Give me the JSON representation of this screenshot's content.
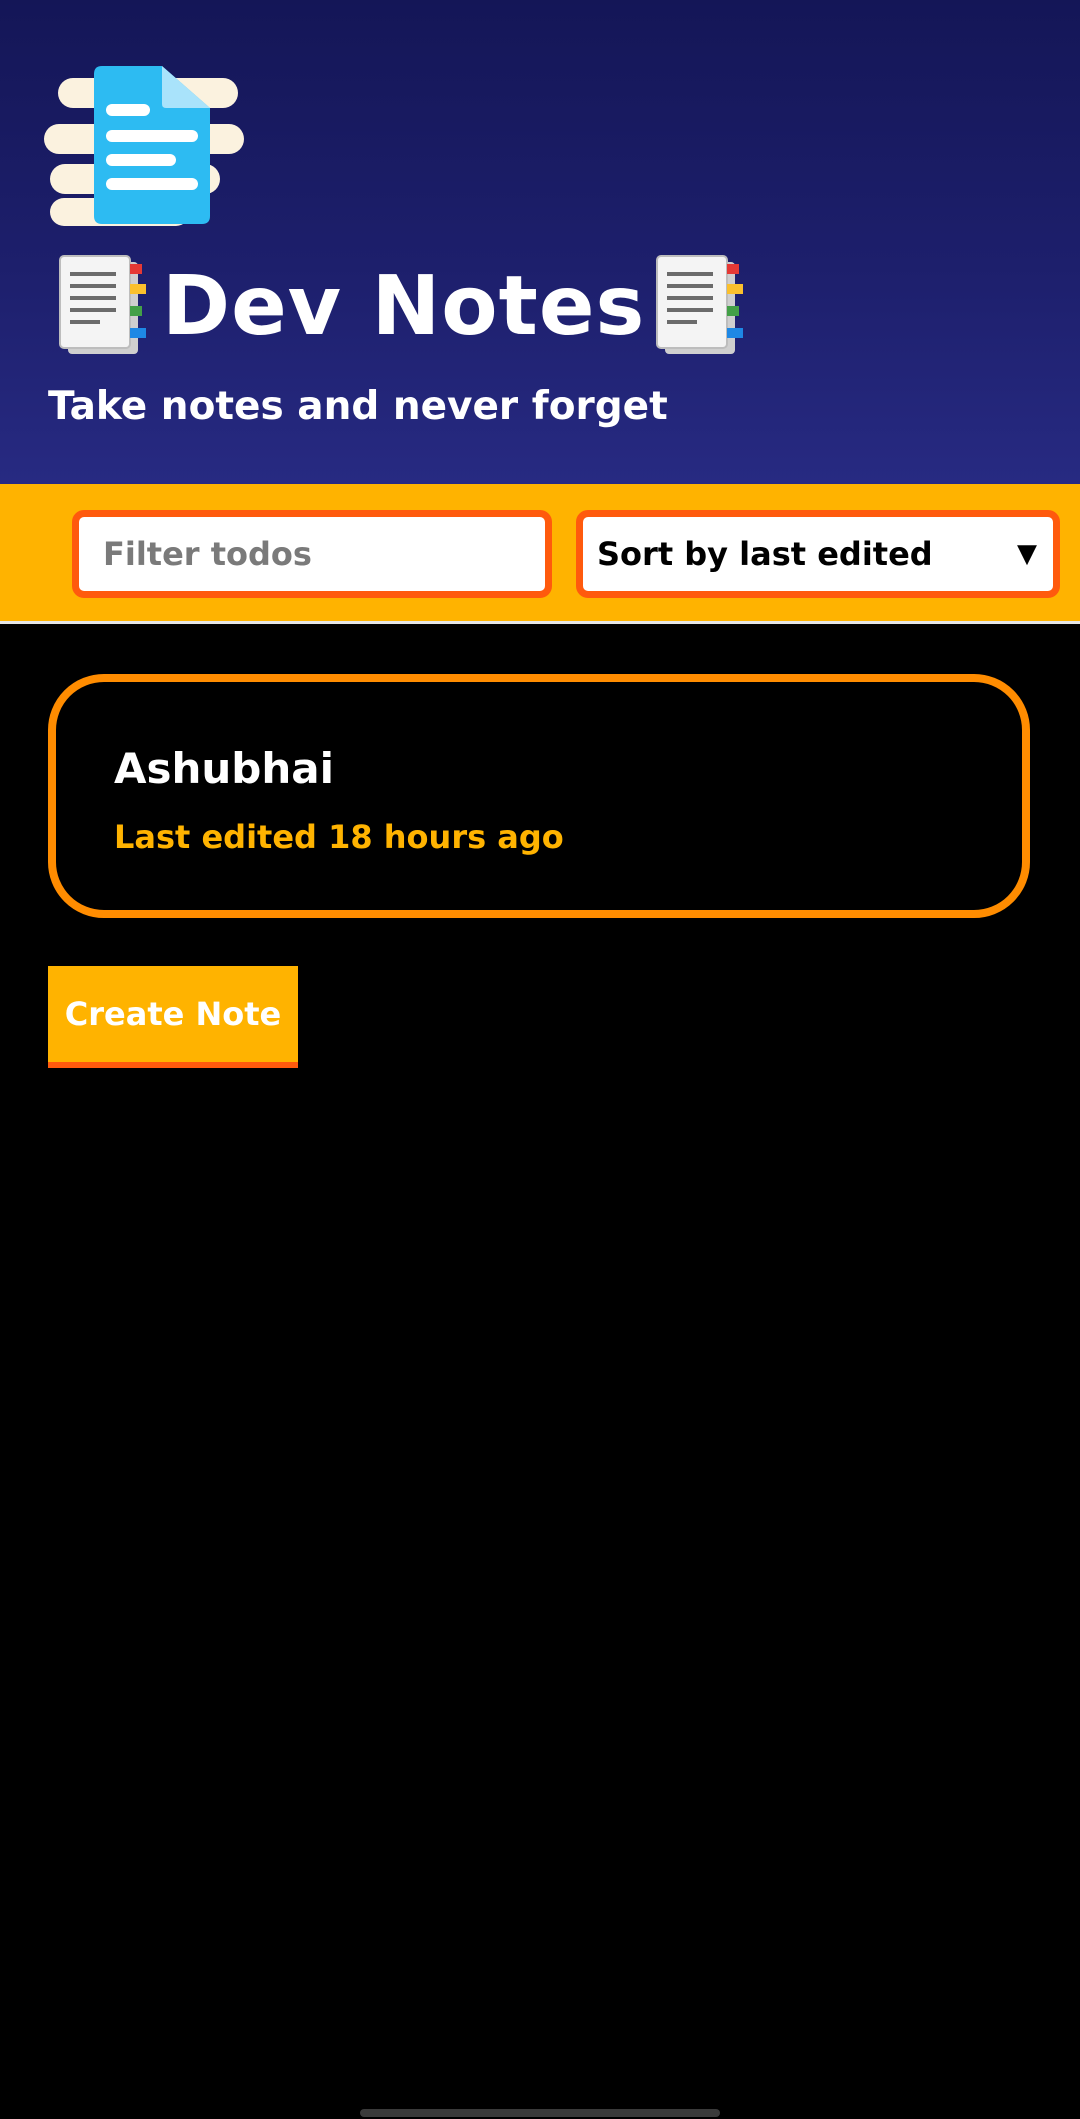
{
  "header": {
    "logo_icon": "document-lines-icon",
    "title": "Dev Notes",
    "title_icons": [
      "notepad-icon",
      "notepad-icon"
    ],
    "subtitle": "Take notes and never forget"
  },
  "toolbar": {
    "filter_placeholder": "Filter todos",
    "filter_value": "",
    "sort_selected": "Sort by last edited",
    "sort_icon": "caret-down-icon"
  },
  "notes": [
    {
      "title": "Ashubhai",
      "meta": "Last edited 18 hours ago"
    }
  ],
  "actions": {
    "create_label": "Create Note"
  },
  "colors": {
    "header_bg": "#1d1f6c",
    "accent": "#ffb300",
    "border_accent": "#ff5a0d",
    "card_border": "#ff8c00",
    "background": "#000000"
  }
}
